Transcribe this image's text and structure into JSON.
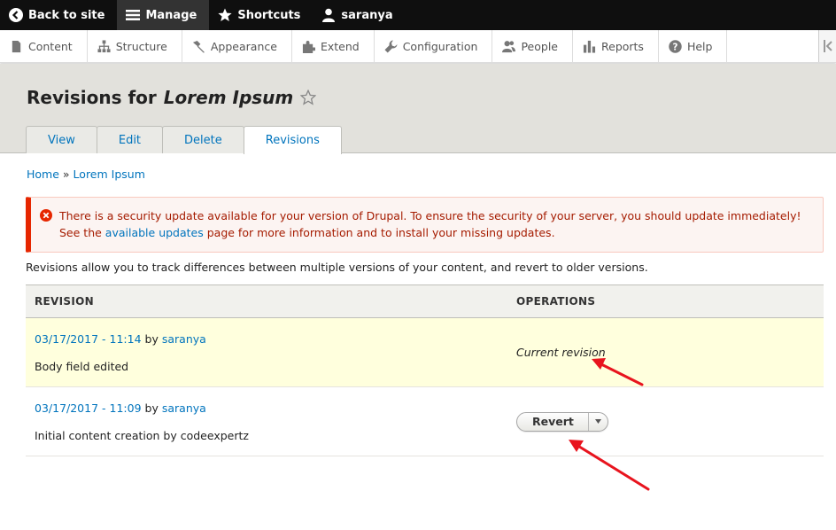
{
  "toolbar": {
    "back_label": "Back to site",
    "manage_label": "Manage",
    "shortcuts_label": "Shortcuts",
    "user_label": "saranya"
  },
  "tray": {
    "items": [
      {
        "label": "Content",
        "icon": "file-icon"
      },
      {
        "label": "Structure",
        "icon": "sitemap-icon"
      },
      {
        "label": "Appearance",
        "icon": "paintbrush-icon"
      },
      {
        "label": "Extend",
        "icon": "puzzle-icon"
      },
      {
        "label": "Configuration",
        "icon": "wrench-icon"
      },
      {
        "label": "People",
        "icon": "people-icon"
      },
      {
        "label": "Reports",
        "icon": "bar-chart-icon"
      },
      {
        "label": "Help",
        "icon": "help-icon"
      }
    ]
  },
  "page": {
    "title_prefix": "Revisions for",
    "title_node": "Lorem Ipsum"
  },
  "tabs": [
    {
      "label": "View"
    },
    {
      "label": "Edit"
    },
    {
      "label": "Delete"
    },
    {
      "label": "Revisions",
      "active": true
    }
  ],
  "breadcrumb": {
    "home": "Home",
    "separator": "»",
    "current": "Lorem Ipsum"
  },
  "alert": {
    "text_before": "There is a security update available for your version of Drupal. To ensure the security of your server, you should update immediately! See the",
    "link": "available updates",
    "text_after": "page for more information and to install your missing updates."
  },
  "intro": "Revisions allow you to track differences between multiple versions of your content, and revert to older versions.",
  "table": {
    "headers": [
      "REVISION",
      "OPERATIONS"
    ],
    "rows": [
      {
        "date": "03/17/2017 - 11:14",
        "by": "by",
        "author": "saranya",
        "message": "Body field edited",
        "operation": "Current revision"
      },
      {
        "date": "03/17/2017 - 11:09",
        "by": "by",
        "author": "saranya",
        "message": "Initial content creation by codeexpertz",
        "operation": "Revert"
      }
    ]
  },
  "colors": {
    "link": "#0074bd",
    "error": "#e62600",
    "arrow": "#e8141e",
    "current_row": "#ffffdd"
  }
}
